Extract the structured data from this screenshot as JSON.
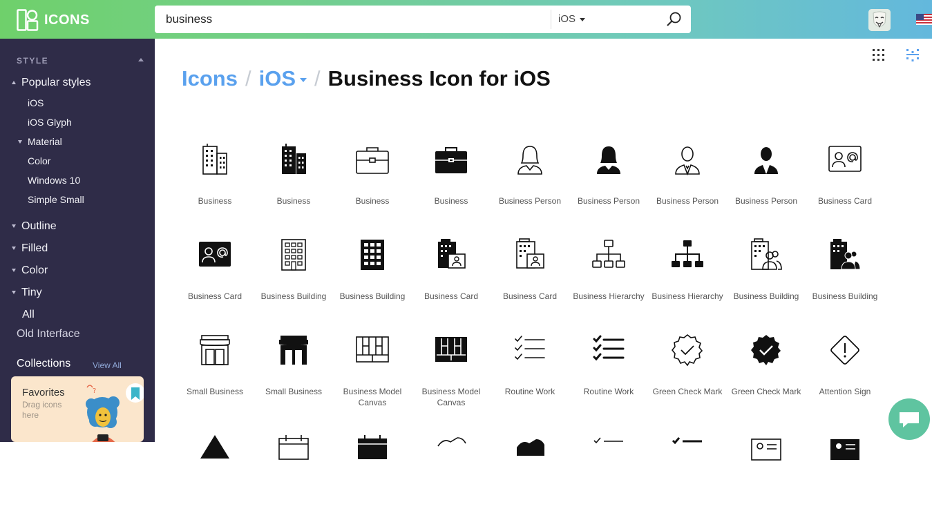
{
  "brand": {
    "name": "ICONS"
  },
  "search": {
    "value": "business",
    "platform": "iOS"
  },
  "sidebar": {
    "heading": "STYLE",
    "popular_label": "Popular styles",
    "popular_items": [
      "iOS",
      "iOS Glyph",
      "Material",
      "Color",
      "Windows 10",
      "Simple Small"
    ],
    "groups": [
      "Outline",
      "Filled",
      "Color",
      "Tiny"
    ],
    "all_label": "All",
    "old_label": "Old Interface",
    "collections_label": "Collections",
    "view_all_label": "View All",
    "favorites": {
      "title": "Favorites",
      "subtitle": "Drag icons here"
    }
  },
  "breadcrumb": {
    "root": "Icons",
    "sep": "/",
    "platform": "iOS",
    "current": "Business Icon for iOS"
  },
  "icons": [
    {
      "label": "Business",
      "icon": "office-building-outline"
    },
    {
      "label": "Business",
      "icon": "office-building-filled"
    },
    {
      "label": "Business",
      "icon": "briefcase-outline"
    },
    {
      "label": "Business",
      "icon": "briefcase-filled"
    },
    {
      "label": "Business Person",
      "icon": "businesswoman-outline"
    },
    {
      "label": "Business Person",
      "icon": "businesswoman-filled"
    },
    {
      "label": "Business Person",
      "icon": "businessman-outline"
    },
    {
      "label": "Business Person",
      "icon": "businessman-filled"
    },
    {
      "label": "Business Card",
      "icon": "contact-card-outline"
    },
    {
      "label": "Business Card",
      "icon": "contact-card-filled"
    },
    {
      "label": "Business Building",
      "icon": "building-grid-outline"
    },
    {
      "label": "Business Building",
      "icon": "building-grid-filled"
    },
    {
      "label": "Business Card",
      "icon": "building-card-filled"
    },
    {
      "label": "Business Card",
      "icon": "building-card-outline"
    },
    {
      "label": "Business Hierarchy",
      "icon": "hierarchy-outline"
    },
    {
      "label": "Business Hierarchy",
      "icon": "hierarchy-filled"
    },
    {
      "label": "Business Building",
      "icon": "building-people-outline"
    },
    {
      "label": "Business Building",
      "icon": "building-people-filled"
    },
    {
      "label": "Small Business",
      "icon": "shop-outline"
    },
    {
      "label": "Small Business",
      "icon": "shop-filled"
    },
    {
      "label": "Business Model Canvas",
      "icon": "canvas-outline"
    },
    {
      "label": "Business Model Canvas",
      "icon": "canvas-filled"
    },
    {
      "label": "Routine Work",
      "icon": "checklist-outline"
    },
    {
      "label": "Routine Work",
      "icon": "checklist-filled"
    },
    {
      "label": "Green Check Mark",
      "icon": "badge-check-outline"
    },
    {
      "label": "Green Check Mark",
      "icon": "badge-check-filled"
    },
    {
      "label": "Attention Sign",
      "icon": "attention-diamond-outline"
    }
  ]
}
